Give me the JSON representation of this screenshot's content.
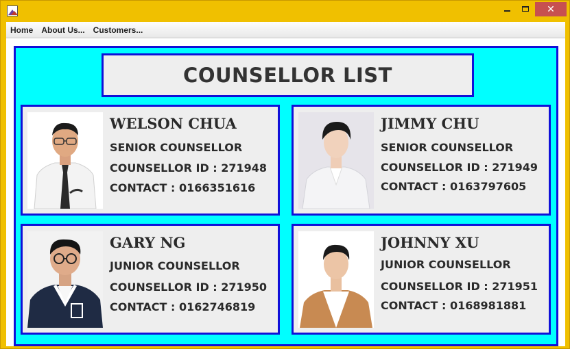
{
  "window": {
    "minimize_icon": "minimize-icon",
    "maximize_icon": "maximize-icon",
    "close_label": "✕"
  },
  "menu": {
    "items": [
      {
        "label": "Home"
      },
      {
        "label": "About Us..."
      },
      {
        "label": "Customers..."
      }
    ]
  },
  "title": "COUNSELLOR LIST",
  "colors": {
    "panel_bg": "#00ffff",
    "border": "#1010d8",
    "card_bg": "#eeeeee",
    "frame": "#f0c000"
  },
  "counsellors": [
    {
      "name": "WELSON CHUA",
      "role": "SENIOR COUNSELLOR",
      "id_line": "COUNSELLOR ID : 271948",
      "contact_line": "CONTACT : 0166351616"
    },
    {
      "name": "JIMMY CHU",
      "role": "SENIOR COUNSELLOR",
      "id_line": "COUNSELLOR ID : 271949",
      "contact_line": "CONTACT : 0163797605"
    },
    {
      "name": "GARY NG",
      "role": "JUNIOR COUNSELLOR",
      "id_line": "COUNSELLOR ID : 271950",
      "contact_line": "CONTACT : 0162746819"
    },
    {
      "name": "JOHNNY XU",
      "role": "JUNIOR COUNSELLOR",
      "id_line": "COUNSELLOR ID : 271951",
      "contact_line": "CONTACT : 0168981881"
    }
  ]
}
